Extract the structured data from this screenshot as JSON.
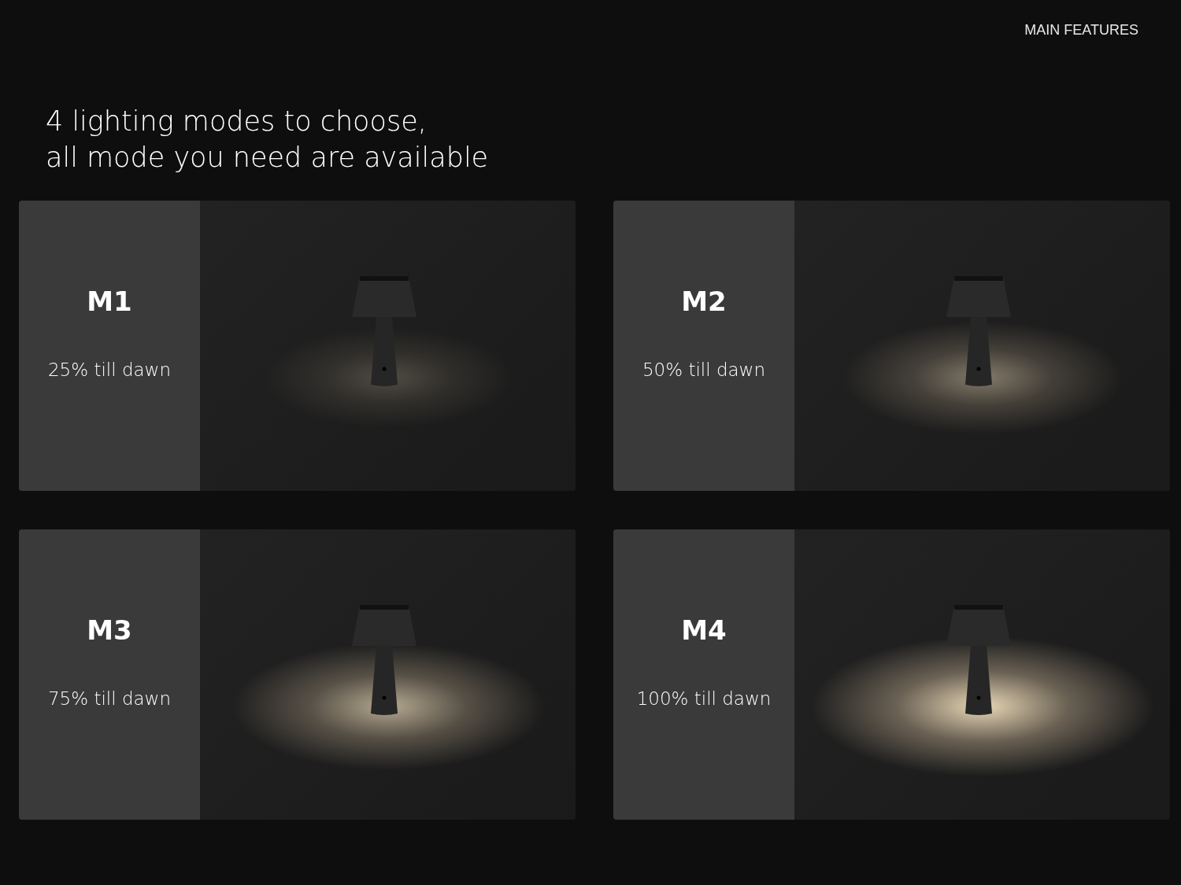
{
  "header": {
    "section": "MAIN FEATURES"
  },
  "headline": [
    "4 lighting modes to choose,",
    "all mode you need are available"
  ],
  "modes": [
    {
      "name": "M1",
      "caption": "25% till dawn",
      "kind": "quarter"
    },
    {
      "name": "M2",
      "caption": "50% till dawn",
      "kind": "half"
    },
    {
      "name": "M3",
      "caption": "75% till dawn",
      "kind": "strong"
    },
    {
      "name": "M4",
      "caption": "100% till dawn",
      "kind": "full"
    }
  ]
}
